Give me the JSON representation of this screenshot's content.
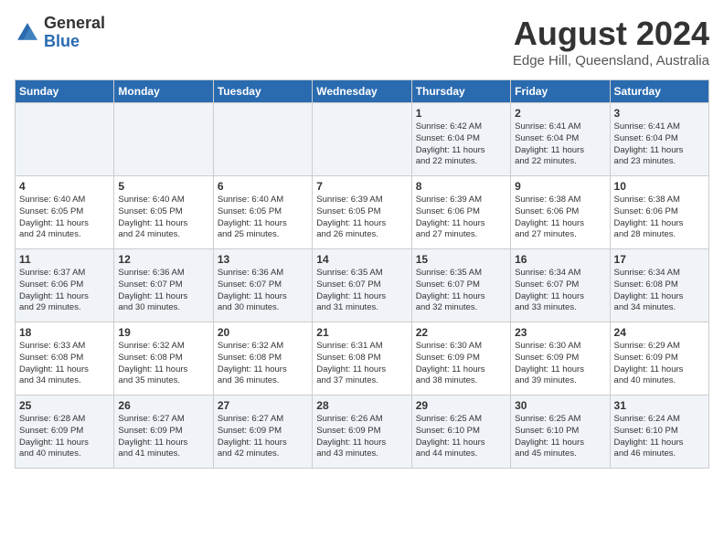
{
  "header": {
    "logo_general": "General",
    "logo_blue": "Blue",
    "month_title": "August 2024",
    "location": "Edge Hill, Queensland, Australia"
  },
  "days_of_week": [
    "Sunday",
    "Monday",
    "Tuesday",
    "Wednesday",
    "Thursday",
    "Friday",
    "Saturday"
  ],
  "weeks": [
    [
      {
        "day": "",
        "info": ""
      },
      {
        "day": "",
        "info": ""
      },
      {
        "day": "",
        "info": ""
      },
      {
        "day": "",
        "info": ""
      },
      {
        "day": "1",
        "info": "Sunrise: 6:42 AM\nSunset: 6:04 PM\nDaylight: 11 hours\nand 22 minutes."
      },
      {
        "day": "2",
        "info": "Sunrise: 6:41 AM\nSunset: 6:04 PM\nDaylight: 11 hours\nand 22 minutes."
      },
      {
        "day": "3",
        "info": "Sunrise: 6:41 AM\nSunset: 6:04 PM\nDaylight: 11 hours\nand 23 minutes."
      }
    ],
    [
      {
        "day": "4",
        "info": "Sunrise: 6:40 AM\nSunset: 6:05 PM\nDaylight: 11 hours\nand 24 minutes."
      },
      {
        "day": "5",
        "info": "Sunrise: 6:40 AM\nSunset: 6:05 PM\nDaylight: 11 hours\nand 24 minutes."
      },
      {
        "day": "6",
        "info": "Sunrise: 6:40 AM\nSunset: 6:05 PM\nDaylight: 11 hours\nand 25 minutes."
      },
      {
        "day": "7",
        "info": "Sunrise: 6:39 AM\nSunset: 6:05 PM\nDaylight: 11 hours\nand 26 minutes."
      },
      {
        "day": "8",
        "info": "Sunrise: 6:39 AM\nSunset: 6:06 PM\nDaylight: 11 hours\nand 27 minutes."
      },
      {
        "day": "9",
        "info": "Sunrise: 6:38 AM\nSunset: 6:06 PM\nDaylight: 11 hours\nand 27 minutes."
      },
      {
        "day": "10",
        "info": "Sunrise: 6:38 AM\nSunset: 6:06 PM\nDaylight: 11 hours\nand 28 minutes."
      }
    ],
    [
      {
        "day": "11",
        "info": "Sunrise: 6:37 AM\nSunset: 6:06 PM\nDaylight: 11 hours\nand 29 minutes."
      },
      {
        "day": "12",
        "info": "Sunrise: 6:36 AM\nSunset: 6:07 PM\nDaylight: 11 hours\nand 30 minutes."
      },
      {
        "day": "13",
        "info": "Sunrise: 6:36 AM\nSunset: 6:07 PM\nDaylight: 11 hours\nand 30 minutes."
      },
      {
        "day": "14",
        "info": "Sunrise: 6:35 AM\nSunset: 6:07 PM\nDaylight: 11 hours\nand 31 minutes."
      },
      {
        "day": "15",
        "info": "Sunrise: 6:35 AM\nSunset: 6:07 PM\nDaylight: 11 hours\nand 32 minutes."
      },
      {
        "day": "16",
        "info": "Sunrise: 6:34 AM\nSunset: 6:07 PM\nDaylight: 11 hours\nand 33 minutes."
      },
      {
        "day": "17",
        "info": "Sunrise: 6:34 AM\nSunset: 6:08 PM\nDaylight: 11 hours\nand 34 minutes."
      }
    ],
    [
      {
        "day": "18",
        "info": "Sunrise: 6:33 AM\nSunset: 6:08 PM\nDaylight: 11 hours\nand 34 minutes."
      },
      {
        "day": "19",
        "info": "Sunrise: 6:32 AM\nSunset: 6:08 PM\nDaylight: 11 hours\nand 35 minutes."
      },
      {
        "day": "20",
        "info": "Sunrise: 6:32 AM\nSunset: 6:08 PM\nDaylight: 11 hours\nand 36 minutes."
      },
      {
        "day": "21",
        "info": "Sunrise: 6:31 AM\nSunset: 6:08 PM\nDaylight: 11 hours\nand 37 minutes."
      },
      {
        "day": "22",
        "info": "Sunrise: 6:30 AM\nSunset: 6:09 PM\nDaylight: 11 hours\nand 38 minutes."
      },
      {
        "day": "23",
        "info": "Sunrise: 6:30 AM\nSunset: 6:09 PM\nDaylight: 11 hours\nand 39 minutes."
      },
      {
        "day": "24",
        "info": "Sunrise: 6:29 AM\nSunset: 6:09 PM\nDaylight: 11 hours\nand 40 minutes."
      }
    ],
    [
      {
        "day": "25",
        "info": "Sunrise: 6:28 AM\nSunset: 6:09 PM\nDaylight: 11 hours\nand 40 minutes."
      },
      {
        "day": "26",
        "info": "Sunrise: 6:27 AM\nSunset: 6:09 PM\nDaylight: 11 hours\nand 41 minutes."
      },
      {
        "day": "27",
        "info": "Sunrise: 6:27 AM\nSunset: 6:09 PM\nDaylight: 11 hours\nand 42 minutes."
      },
      {
        "day": "28",
        "info": "Sunrise: 6:26 AM\nSunset: 6:09 PM\nDaylight: 11 hours\nand 43 minutes."
      },
      {
        "day": "29",
        "info": "Sunrise: 6:25 AM\nSunset: 6:10 PM\nDaylight: 11 hours\nand 44 minutes."
      },
      {
        "day": "30",
        "info": "Sunrise: 6:25 AM\nSunset: 6:10 PM\nDaylight: 11 hours\nand 45 minutes."
      },
      {
        "day": "31",
        "info": "Sunrise: 6:24 AM\nSunset: 6:10 PM\nDaylight: 11 hours\nand 46 minutes."
      }
    ]
  ]
}
